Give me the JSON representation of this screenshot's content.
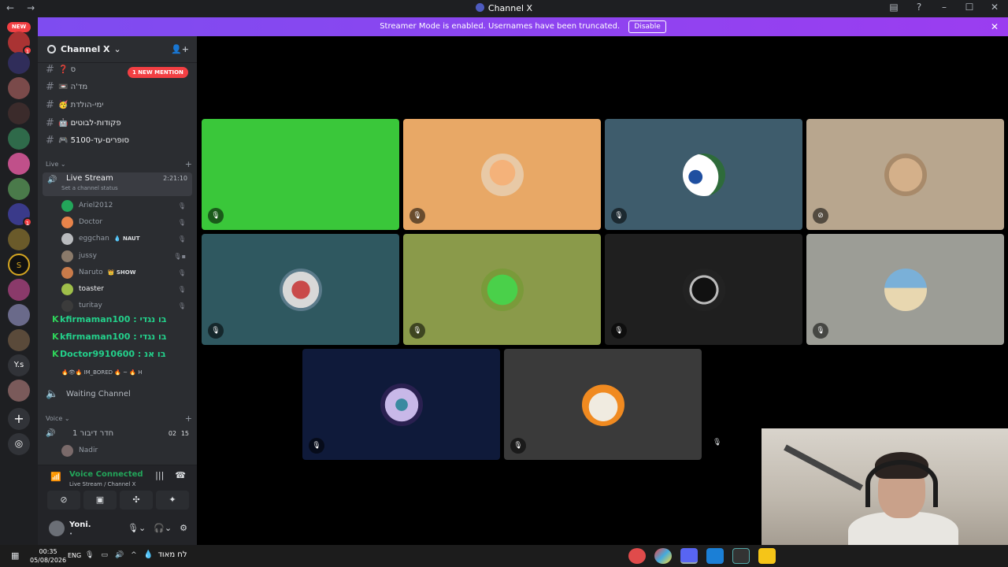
{
  "window": {
    "title": "Channel X"
  },
  "banner": {
    "text": "Streamer Mode is enabled. Usernames have been truncated.",
    "button": "Disable"
  },
  "rail": {
    "new_label": "NEW",
    "text_servers": [
      "S",
      "Y.s"
    ]
  },
  "guild": {
    "name": "Channel X"
  },
  "mention_badge": "1 NEW MENTION",
  "text_channels": [
    {
      "label": "❓ ס"
    },
    {
      "label": "📼 מד'ה"
    },
    {
      "label": "🥳 ימי-הולדת"
    },
    {
      "label": "🤖 פקודות-לבוטים"
    },
    {
      "label": "🎮 סופרים-עד-5100"
    }
  ],
  "live_category": "Live",
  "live_channel": {
    "name": "Live Stream",
    "time": "2:21:10",
    "status": "Set a channel status"
  },
  "live_users": [
    {
      "name": "Ariel2012",
      "color": "#23a55a",
      "tag": ""
    },
    {
      "name": "Doctor",
      "color": "#e8834a",
      "tag": ""
    },
    {
      "name": "eggchan",
      "color": "#b9bbbe",
      "tag": "💧 NAUT"
    },
    {
      "name": "jussy",
      "color": "#8a7a6a",
      "tag": ""
    },
    {
      "name": "Naruto",
      "color": "#c97b4a",
      "tag": "👑 SHOW"
    },
    {
      "name": "toaster",
      "color": "#9fbf4a",
      "tag": ""
    },
    {
      "name": "turitay",
      "color": "#3b3b3b",
      "tag": ""
    }
  ],
  "spam_rows": [
    {
      "text": "kfirmaman100 : בו נגדי"
    },
    {
      "text": "kfirmaman100 : בו נגדי"
    },
    {
      "text": "Doctor9910600 : בו אנ"
    }
  ],
  "spam_small": "🔥👁🔥 IM_BORED 🔥 ~ 🔥 H",
  "waiting_channel": "Waiting Channel",
  "voice_category": "Voice",
  "voice_channel": {
    "name": "חדר דיבור 1",
    "count_a": "02",
    "count_b": "15"
  },
  "voice_users": [
    {
      "name": "Nadir"
    }
  ],
  "voice_panel": {
    "connected": "Voice Connected",
    "sub": "Live Stream / Channel X"
  },
  "self_user": {
    "name": "Yoni.",
    "status": "•"
  },
  "tiles": [
    {
      "bg": "#3ac73a",
      "avatar": "none"
    },
    {
      "bg": "#e8a866",
      "avatar": "cat-orange"
    },
    {
      "bg": "#3e5c6c",
      "avatar": "eyeball"
    },
    {
      "bg": "#b8a68e",
      "avatar": "cat-face"
    },
    {
      "bg": "#2f5860",
      "avatar": "mask"
    },
    {
      "bg": "#8a9a4a",
      "avatar": "green-creature"
    },
    {
      "bg": "#1f1f1f",
      "avatar": "dark-art"
    },
    {
      "bg": "#9c9d96",
      "avatar": "beach"
    },
    {
      "bg": "#0f1a3a",
      "avatar": "pixel-moon"
    },
    {
      "bg": "#3a3a3a",
      "avatar": "skull-balls"
    }
  ],
  "taskbar": {
    "time": "00:35",
    "date": "05/08/2026",
    "lang": "ENG",
    "weather": "לח מאוד"
  },
  "colors": {
    "accent": "#5865f2",
    "online": "#23a55a",
    "danger": "#f23f43"
  }
}
